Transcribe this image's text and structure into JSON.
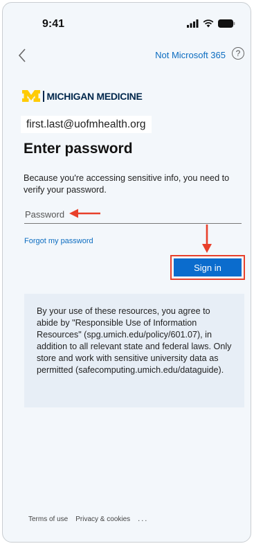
{
  "status_bar": {
    "time": "9:41"
  },
  "header": {
    "not_microsoft_label": "Not Microsoft 365",
    "help_glyph": "?"
  },
  "brand": {
    "logo_text": "MICHIGAN MEDICINE",
    "logo_color": "#00274c",
    "maize_color": "#ffcb05"
  },
  "account": {
    "email": "first.last@uofmhealth.org"
  },
  "main": {
    "title": "Enter password",
    "description": "Because you're accessing sensitive info, you need to verify your password.",
    "password_placeholder": "Password",
    "forgot_password_label": "Forgot my password",
    "sign_in_label": "Sign in"
  },
  "notice": {
    "text": "By your use of these resources, you agree to abide by \"Responsible Use of Information Resources\" (spg.umich.edu/policy/601.07), in addition to all relevant state and federal laws. Only store and work with sensitive university data as permitted (safecomputing.umich.edu/dataguide)."
  },
  "footer": {
    "terms_label": "Terms of use",
    "privacy_label": "Privacy & cookies",
    "more_label": "..."
  },
  "colors": {
    "accent": "#0b6ccd",
    "link": "#0b6cc0",
    "annotation": "#e8402b",
    "background": "#f3f7fb"
  }
}
